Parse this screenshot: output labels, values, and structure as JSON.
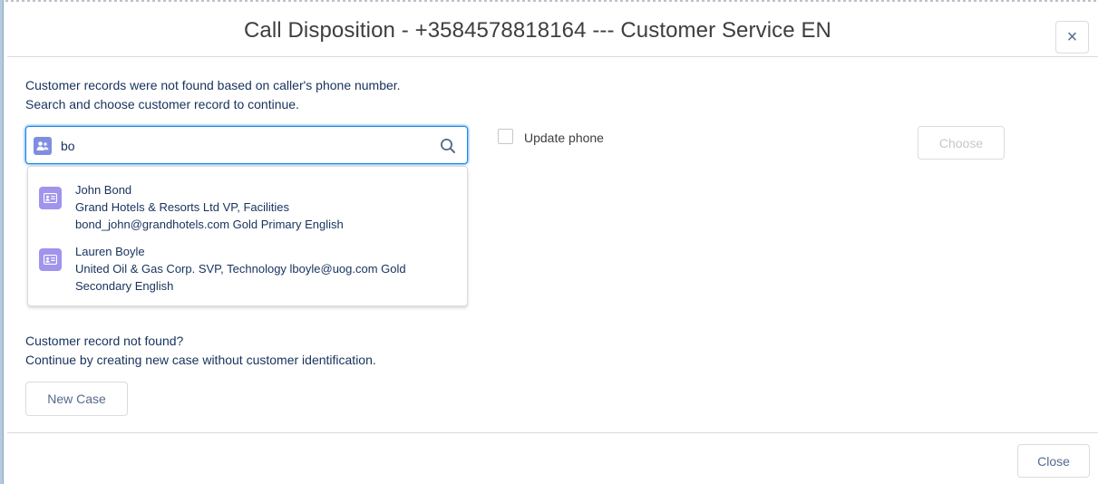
{
  "modal": {
    "title": "Call Disposition - +3584578818164 --- Customer Service EN",
    "close_icon": "×"
  },
  "intro": {
    "line1": "Customer records were not found based on caller's phone number.",
    "line2": "Search and choose customer record to continue."
  },
  "search": {
    "value": "bo",
    "badge_icon": "contact-icon",
    "search_icon": "search-icon"
  },
  "results": [
    {
      "name": "John Bond",
      "line2": "Grand Hotels & Resorts Ltd VP, Facilities",
      "line3": "bond_john@grandhotels.com Gold Primary English",
      "icon": "contact-card-icon"
    },
    {
      "name": "Lauren Boyle",
      "line2": "United Oil & Gas Corp. SVP, Technology lboyle@uog.com Gold",
      "line3": "Secondary English",
      "icon": "contact-card-icon"
    }
  ],
  "update_phone": {
    "label": "Update phone",
    "checked": false
  },
  "choose_label": "Choose",
  "not_found": {
    "line1": "Customer record not found?",
    "line2": "Continue by creating new case without customer identification."
  },
  "new_case_label": "New Case",
  "footer": {
    "close_label": "Close"
  },
  "colors": {
    "accent_blue": "#1589ee",
    "contact_purple": "#a094ed",
    "text_dark": "#16325c",
    "border": "#dddbda"
  }
}
